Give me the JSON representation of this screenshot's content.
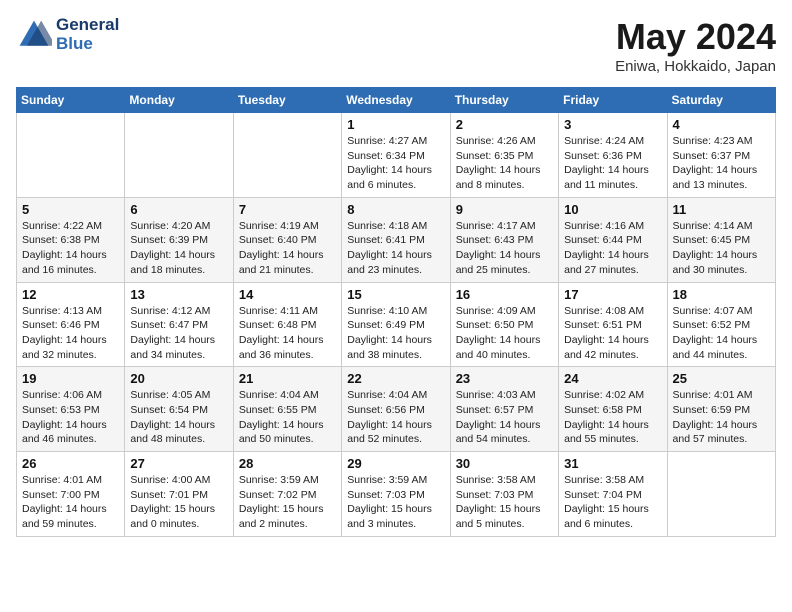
{
  "logo": {
    "line1": "General",
    "line2": "Blue"
  },
  "title": "May 2024",
  "location": "Eniwa, Hokkaido, Japan",
  "weekdays": [
    "Sunday",
    "Monday",
    "Tuesday",
    "Wednesday",
    "Thursday",
    "Friday",
    "Saturday"
  ],
  "weeks": [
    [
      {
        "day": "",
        "info": ""
      },
      {
        "day": "",
        "info": ""
      },
      {
        "day": "",
        "info": ""
      },
      {
        "day": "1",
        "info": "Sunrise: 4:27 AM\nSunset: 6:34 PM\nDaylight: 14 hours\nand 6 minutes."
      },
      {
        "day": "2",
        "info": "Sunrise: 4:26 AM\nSunset: 6:35 PM\nDaylight: 14 hours\nand 8 minutes."
      },
      {
        "day": "3",
        "info": "Sunrise: 4:24 AM\nSunset: 6:36 PM\nDaylight: 14 hours\nand 11 minutes."
      },
      {
        "day": "4",
        "info": "Sunrise: 4:23 AM\nSunset: 6:37 PM\nDaylight: 14 hours\nand 13 minutes."
      }
    ],
    [
      {
        "day": "5",
        "info": "Sunrise: 4:22 AM\nSunset: 6:38 PM\nDaylight: 14 hours\nand 16 minutes."
      },
      {
        "day": "6",
        "info": "Sunrise: 4:20 AM\nSunset: 6:39 PM\nDaylight: 14 hours\nand 18 minutes."
      },
      {
        "day": "7",
        "info": "Sunrise: 4:19 AM\nSunset: 6:40 PM\nDaylight: 14 hours\nand 21 minutes."
      },
      {
        "day": "8",
        "info": "Sunrise: 4:18 AM\nSunset: 6:41 PM\nDaylight: 14 hours\nand 23 minutes."
      },
      {
        "day": "9",
        "info": "Sunrise: 4:17 AM\nSunset: 6:43 PM\nDaylight: 14 hours\nand 25 minutes."
      },
      {
        "day": "10",
        "info": "Sunrise: 4:16 AM\nSunset: 6:44 PM\nDaylight: 14 hours\nand 27 minutes."
      },
      {
        "day": "11",
        "info": "Sunrise: 4:14 AM\nSunset: 6:45 PM\nDaylight: 14 hours\nand 30 minutes."
      }
    ],
    [
      {
        "day": "12",
        "info": "Sunrise: 4:13 AM\nSunset: 6:46 PM\nDaylight: 14 hours\nand 32 minutes."
      },
      {
        "day": "13",
        "info": "Sunrise: 4:12 AM\nSunset: 6:47 PM\nDaylight: 14 hours\nand 34 minutes."
      },
      {
        "day": "14",
        "info": "Sunrise: 4:11 AM\nSunset: 6:48 PM\nDaylight: 14 hours\nand 36 minutes."
      },
      {
        "day": "15",
        "info": "Sunrise: 4:10 AM\nSunset: 6:49 PM\nDaylight: 14 hours\nand 38 minutes."
      },
      {
        "day": "16",
        "info": "Sunrise: 4:09 AM\nSunset: 6:50 PM\nDaylight: 14 hours\nand 40 minutes."
      },
      {
        "day": "17",
        "info": "Sunrise: 4:08 AM\nSunset: 6:51 PM\nDaylight: 14 hours\nand 42 minutes."
      },
      {
        "day": "18",
        "info": "Sunrise: 4:07 AM\nSunset: 6:52 PM\nDaylight: 14 hours\nand 44 minutes."
      }
    ],
    [
      {
        "day": "19",
        "info": "Sunrise: 4:06 AM\nSunset: 6:53 PM\nDaylight: 14 hours\nand 46 minutes."
      },
      {
        "day": "20",
        "info": "Sunrise: 4:05 AM\nSunset: 6:54 PM\nDaylight: 14 hours\nand 48 minutes."
      },
      {
        "day": "21",
        "info": "Sunrise: 4:04 AM\nSunset: 6:55 PM\nDaylight: 14 hours\nand 50 minutes."
      },
      {
        "day": "22",
        "info": "Sunrise: 4:04 AM\nSunset: 6:56 PM\nDaylight: 14 hours\nand 52 minutes."
      },
      {
        "day": "23",
        "info": "Sunrise: 4:03 AM\nSunset: 6:57 PM\nDaylight: 14 hours\nand 54 minutes."
      },
      {
        "day": "24",
        "info": "Sunrise: 4:02 AM\nSunset: 6:58 PM\nDaylight: 14 hours\nand 55 minutes."
      },
      {
        "day": "25",
        "info": "Sunrise: 4:01 AM\nSunset: 6:59 PM\nDaylight: 14 hours\nand 57 minutes."
      }
    ],
    [
      {
        "day": "26",
        "info": "Sunrise: 4:01 AM\nSunset: 7:00 PM\nDaylight: 14 hours\nand 59 minutes."
      },
      {
        "day": "27",
        "info": "Sunrise: 4:00 AM\nSunset: 7:01 PM\nDaylight: 15 hours\nand 0 minutes."
      },
      {
        "day": "28",
        "info": "Sunrise: 3:59 AM\nSunset: 7:02 PM\nDaylight: 15 hours\nand 2 minutes."
      },
      {
        "day": "29",
        "info": "Sunrise: 3:59 AM\nSunset: 7:03 PM\nDaylight: 15 hours\nand 3 minutes."
      },
      {
        "day": "30",
        "info": "Sunrise: 3:58 AM\nSunset: 7:03 PM\nDaylight: 15 hours\nand 5 minutes."
      },
      {
        "day": "31",
        "info": "Sunrise: 3:58 AM\nSunset: 7:04 PM\nDaylight: 15 hours\nand 6 minutes."
      },
      {
        "day": "",
        "info": ""
      }
    ]
  ]
}
